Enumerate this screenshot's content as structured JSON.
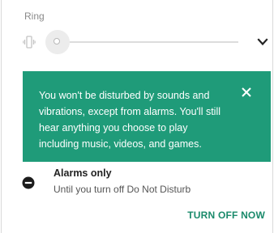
{
  "ringer": {
    "label": "Ring",
    "mode_icon": "vibrate-icon",
    "volume_fraction": 0.0,
    "expand_icon": "chevron-down-icon"
  },
  "dnd_banner": {
    "message": "You won't be disturbed by sounds and vibrations, except from alarms. You'll still hear anything you choose to play including music, videos, and games.",
    "close_icon": "close-icon",
    "background_color": "#1f9b79"
  },
  "dnd_mode": {
    "icon": "do-not-disturb-icon",
    "title": "Alarms only",
    "subtitle": "Until you turn off Do Not Disturb"
  },
  "actions": {
    "turn_off_label": "TURN OFF NOW",
    "accent_color": "#1a8a6b"
  }
}
